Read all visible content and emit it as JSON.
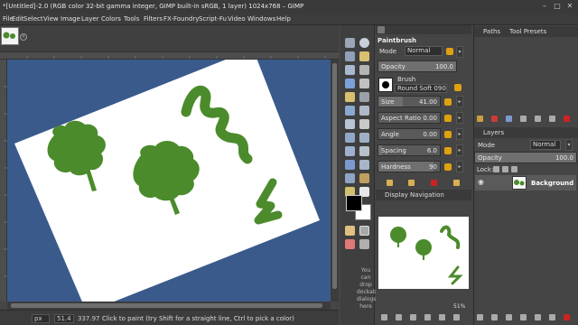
{
  "window": {
    "title": "*[Untitled]-2.0 (RGB color 32-bit gamma integer, GIMP built-in sRGB, 1 layer) 1024x768 – GIMP",
    "controls": {
      "minimize": "–",
      "maximize": "□",
      "close": "✕"
    }
  },
  "menu": [
    "File",
    "Edit",
    "Select",
    "View",
    "Image",
    "Layer",
    "Colors",
    "Tools",
    "Filters",
    "FX-Foundry",
    "Script-Fu",
    "Video",
    "Windows",
    "Help"
  ],
  "image_tabs": {
    "close": "×"
  },
  "status": {
    "unit": "px",
    "zoom": "51.4",
    "coord": "337.97",
    "message": "Click to paint (try Shift for a straight line, Ctrl to pick a color)"
  },
  "tool_options": {
    "title": "Paintbrush",
    "mode_label": "Mode",
    "mode_value": "Normal",
    "opacity_label": "Opacity",
    "opacity_value": "100.0",
    "brush_label": "Brush",
    "brush_name": "Round Soft 090",
    "size_label": "Size",
    "size_value": "41.00",
    "aspect_label": "Aspect Ratio",
    "aspect_value": "0.00",
    "angle_label": "Angle",
    "angle_value": "0.00",
    "spacing_label": "Spacing",
    "spacing_value": "6.0",
    "hardness_label": "Hardness",
    "hardness_value": "90",
    "opacity_level": 1.0,
    "size_level": 0.4,
    "spacing_level": 0.06,
    "hardness_level": 0.9
  },
  "toolbox": {
    "no_dock_text": "You can drop dockable dialogs here"
  },
  "navigation": {
    "tab_label": "Display Navigation",
    "zoom": "51%"
  },
  "paths_dock": {
    "tabs": [
      "Paths",
      "Tool Presets"
    ]
  },
  "layers_dock": {
    "tab_label": "Layers",
    "mode_label": "Mode",
    "mode_value": "Normal",
    "opacity_label": "Opacity",
    "opacity_value": "100.0",
    "lock_label": "Lock:",
    "layers": [
      {
        "name": "Background"
      }
    ]
  },
  "colors": {
    "canvas_bg": "#3a5a8c",
    "paint_green": "#4b8b2b",
    "foreground": "#000000",
    "background": "#ffffff",
    "chain": "#e0a010",
    "error_red": "#cc2222"
  }
}
